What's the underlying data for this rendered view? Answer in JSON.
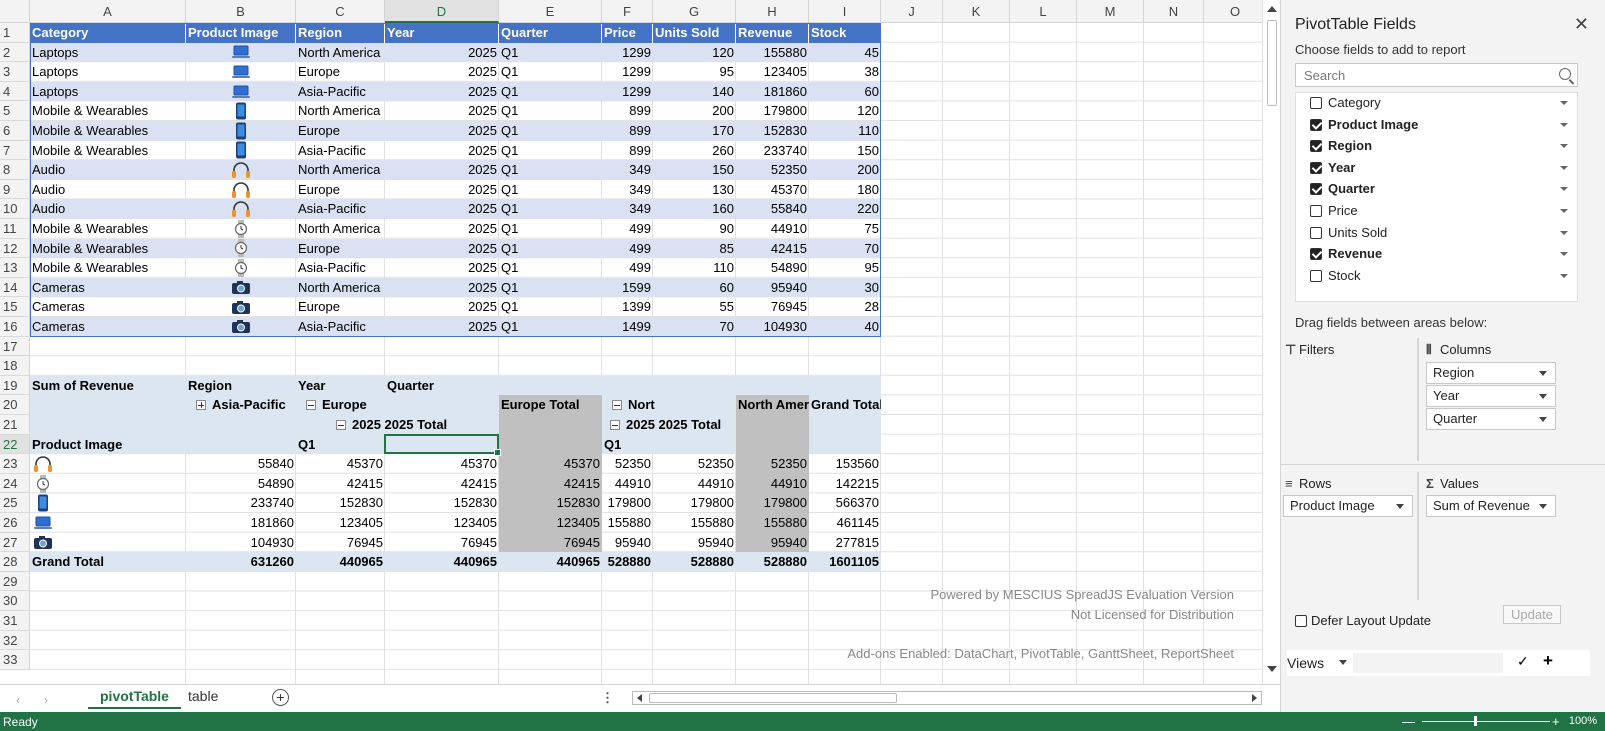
{
  "columns": [
    "A",
    "B",
    "C",
    "D",
    "E",
    "F",
    "G",
    "H",
    "I",
    "J",
    "K",
    "L",
    "M",
    "N",
    "O"
  ],
  "selected_column": "D",
  "rows": [
    "1",
    "2",
    "3",
    "4",
    "5",
    "6",
    "7",
    "8",
    "9",
    "10",
    "11",
    "12",
    "13",
    "14",
    "15",
    "16",
    "17",
    "18",
    "19",
    "20",
    "21",
    "22",
    "23",
    "24",
    "25",
    "26",
    "27",
    "28",
    "29",
    "30",
    "31",
    "32",
    "33"
  ],
  "selected_row": "22",
  "table": {
    "headers": [
      "Category",
      "Product Image",
      "Region",
      "Year",
      "Quarter",
      "Price",
      "Units Sold",
      "Revenue",
      "Stock"
    ],
    "rows": [
      {
        "category": "Laptops",
        "icon": "laptop-icon",
        "region": "North America",
        "year": "2025",
        "quarter": "Q1",
        "price": "1299",
        "units": "120",
        "revenue": "155880",
        "stock": "45"
      },
      {
        "category": "Laptops",
        "icon": "laptop-icon",
        "region": "Europe",
        "year": "2025",
        "quarter": "Q1",
        "price": "1299",
        "units": "95",
        "revenue": "123405",
        "stock": "38"
      },
      {
        "category": "Laptops",
        "icon": "laptop-icon",
        "region": "Asia-Pacific",
        "year": "2025",
        "quarter": "Q1",
        "price": "1299",
        "units": "140",
        "revenue": "181860",
        "stock": "60"
      },
      {
        "category": "Mobile & Wearables",
        "icon": "phone-icon",
        "region": "North America",
        "year": "2025",
        "quarter": "Q1",
        "price": "899",
        "units": "200",
        "revenue": "179800",
        "stock": "120"
      },
      {
        "category": "Mobile & Wearables",
        "icon": "phone-icon",
        "region": "Europe",
        "year": "2025",
        "quarter": "Q1",
        "price": "899",
        "units": "170",
        "revenue": "152830",
        "stock": "110"
      },
      {
        "category": "Mobile & Wearables",
        "icon": "phone-icon",
        "region": "Asia-Pacific",
        "year": "2025",
        "quarter": "Q1",
        "price": "899",
        "units": "260",
        "revenue": "233740",
        "stock": "150"
      },
      {
        "category": "Audio",
        "icon": "headphones-icon",
        "region": "North America",
        "year": "2025",
        "quarter": "Q1",
        "price": "349",
        "units": "150",
        "revenue": "52350",
        "stock": "200"
      },
      {
        "category": "Audio",
        "icon": "headphones-icon",
        "region": "Europe",
        "year": "2025",
        "quarter": "Q1",
        "price": "349",
        "units": "130",
        "revenue": "45370",
        "stock": "180"
      },
      {
        "category": "Audio",
        "icon": "headphones-icon",
        "region": "Asia-Pacific",
        "year": "2025",
        "quarter": "Q1",
        "price": "349",
        "units": "160",
        "revenue": "55840",
        "stock": "220"
      },
      {
        "category": "Mobile & Wearables",
        "icon": "watch-icon",
        "region": "North America",
        "year": "2025",
        "quarter": "Q1",
        "price": "499",
        "units": "90",
        "revenue": "44910",
        "stock": "75"
      },
      {
        "category": "Mobile & Wearables",
        "icon": "watch-icon",
        "region": "Europe",
        "year": "2025",
        "quarter": "Q1",
        "price": "499",
        "units": "85",
        "revenue": "42415",
        "stock": "70"
      },
      {
        "category": "Mobile & Wearables",
        "icon": "watch-icon",
        "region": "Asia-Pacific",
        "year": "2025",
        "quarter": "Q1",
        "price": "499",
        "units": "110",
        "revenue": "54890",
        "stock": "95"
      },
      {
        "category": "Cameras",
        "icon": "camera-icon",
        "region": "North America",
        "year": "2025",
        "quarter": "Q1",
        "price": "1599",
        "units": "60",
        "revenue": "95940",
        "stock": "30"
      },
      {
        "category": "Cameras",
        "icon": "camera-icon",
        "region": "Europe",
        "year": "2025",
        "quarter": "Q1",
        "price": "1399",
        "units": "55",
        "revenue": "76945",
        "stock": "28"
      },
      {
        "category": "Cameras",
        "icon": "camera-icon",
        "region": "Asia-Pacific",
        "year": "2025",
        "quarter": "Q1",
        "price": "1499",
        "units": "70",
        "revenue": "104930",
        "stock": "40"
      }
    ]
  },
  "pivot": {
    "sum_label": "Sum of Revenue",
    "region_label": "Region",
    "year_label": "Year",
    "quarter_label": "Quarter",
    "asia_label": "Asia-Pacific",
    "europe_label": "Europe",
    "europe_total": "Europe Total",
    "nort_label": "Nort",
    "na_total": "North Amer",
    "grand_total_col": "Grand Total",
    "year_2025": "2025",
    "year_total": "2025 Total",
    "year_2025_b": "2025",
    "year_total_b": "2025 Total",
    "product_image_label": "Product Image",
    "q1": "Q1",
    "q1_b": "Q1",
    "rows": [
      {
        "icon": "headphones-icon",
        "values": [
          "55840",
          "45370",
          "45370",
          "45370",
          "52350",
          "52350",
          "52350",
          "153560"
        ]
      },
      {
        "icon": "watch-icon",
        "values": [
          "54890",
          "42415",
          "42415",
          "42415",
          "44910",
          "44910",
          "44910",
          "142215"
        ]
      },
      {
        "icon": "phone-icon",
        "values": [
          "233740",
          "152830",
          "152830",
          "152830",
          "179800",
          "179800",
          "179800",
          "566370"
        ]
      },
      {
        "icon": "laptop-icon",
        "values": [
          "181860",
          "123405",
          "123405",
          "123405",
          "155880",
          "155880",
          "155880",
          "461145"
        ]
      },
      {
        "icon": "camera-icon",
        "values": [
          "104930",
          "76945",
          "76945",
          "76945",
          "95940",
          "95940",
          "95940",
          "277815"
        ]
      }
    ],
    "grand_total_label": "Grand Total",
    "grand_total_values": [
      "631260",
      "440965",
      "440965",
      "440965",
      "528880",
      "528880",
      "528880",
      "1601105"
    ]
  },
  "watermark": {
    "line1": "Powered by MESCIUS SpreadJS Evaluation Version",
    "line2": "Not Licensed for Distribution",
    "line3": "Add-ons Enabled: DataChart, PivotTable, GanttSheet, ReportSheet"
  },
  "tabs": [
    "pivotTable",
    "table"
  ],
  "active_tab": "pivotTable",
  "status": {
    "ready": "Ready",
    "zoom": "100%"
  },
  "panel": {
    "title": "PivotTable Fields",
    "close": "✕",
    "subtitle": "Choose fields to add to report",
    "search_placeholder": "Search",
    "fields": [
      {
        "label": "Category",
        "checked": false
      },
      {
        "label": "Product Image",
        "checked": true
      },
      {
        "label": "Region",
        "checked": true
      },
      {
        "label": "Year",
        "checked": true
      },
      {
        "label": "Quarter",
        "checked": true
      },
      {
        "label": "Price",
        "checked": false
      },
      {
        "label": "Units Sold",
        "checked": false
      },
      {
        "label": "Revenue",
        "checked": true
      },
      {
        "label": "Stock",
        "checked": false
      }
    ],
    "drag_note": "Drag fields between areas below:",
    "filters_label": "Filters",
    "columns_label": "Columns",
    "rows_label": "Rows",
    "values_label": "Values",
    "columns_items": [
      "Region",
      "Year",
      "Quarter"
    ],
    "rows_items": [
      "Product Image"
    ],
    "values_items": [
      "Sum of Revenue"
    ],
    "defer_label": "Defer Layout Update",
    "update_label": "Update",
    "views_label": "Views"
  },
  "colors": {
    "accent": "#217346",
    "table_header": "#4472c4",
    "band": "#d9e1f2",
    "pivot_light": "#dce6f1",
    "pivot_gray": "#c0c0c0"
  }
}
